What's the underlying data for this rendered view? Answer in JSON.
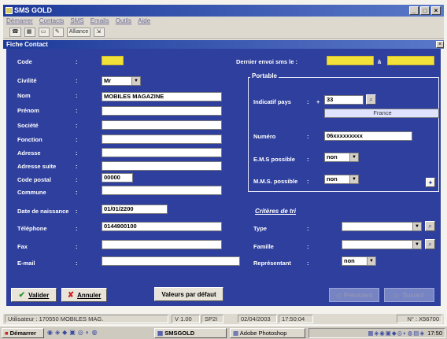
{
  "window": {
    "title": "SMS GOLD",
    "menu": [
      "Démarrer",
      "Contacts",
      "SMS",
      "Emails",
      "Outils",
      "Aide"
    ],
    "toolbar": [
      "Alliance"
    ]
  },
  "dialog": {
    "title": "Fiche Contact"
  },
  "form": {
    "code": {
      "label": "Code",
      "value": ""
    },
    "civilite": {
      "label": "Civilité",
      "value": "Mr"
    },
    "nom": {
      "label": "Nom",
      "value": "MOBILES MAGAZINE"
    },
    "prenom": {
      "label": "Prénom",
      "value": ""
    },
    "societe": {
      "label": "Société",
      "value": ""
    },
    "fonction": {
      "label": "Fonction",
      "value": ""
    },
    "adresse": {
      "label": "Adresse",
      "value": ""
    },
    "adresse_suite": {
      "label": "Adresse suite",
      "value": ""
    },
    "code_postal": {
      "label": "Code postal",
      "value": "00000"
    },
    "commune": {
      "label": "Commune",
      "value": ""
    },
    "date_naissance": {
      "label": "Date de naissance",
      "value": "01/01/2200"
    },
    "telephone": {
      "label": "Téléphone",
      "value": "0144900100"
    },
    "fax": {
      "label": "Fax",
      "value": ""
    },
    "email": {
      "label": "E-mail",
      "value": ""
    }
  },
  "right": {
    "dernier_envoi": {
      "label": "Dernier envoi sms le :",
      "sep": "à",
      "from": "",
      "to": ""
    },
    "portable": {
      "legend": "Portable",
      "indicatif_label": "Indicatif pays",
      "plus": "+",
      "indicatif_value": "33",
      "country": "France",
      "numero_label": "Numéro",
      "numero_value": "06xxxxxxxxx",
      "ems_label": "E.M.S possible",
      "ems_value": "non",
      "mms_label": "M.M.S. possible",
      "mms_value": "non"
    },
    "criteres": {
      "title": "Critères de tri",
      "type_label": "Type",
      "type_value": "",
      "famille_label": "Famille",
      "famille_value": "",
      "representant_label": "Représentant",
      "representant_value": "non"
    }
  },
  "buttons": {
    "valider": "Valider",
    "annuler": "Annuler",
    "defaut": "Valeurs par défaut",
    "precedent": "Précédent",
    "suivant": "Suivant"
  },
  "status": {
    "user": "Utilisateur : 170550 MOBILES MAG.",
    "version": "V 1.00",
    "sp": "SP2I",
    "date": "02/04/2003",
    "time": "17:50:04",
    "num": "N° : X56700"
  },
  "taskbar": {
    "start": "Démarrer",
    "app1": "SMSGOLD",
    "app2": "Adobe Photoshop",
    "clock": "17:50"
  },
  "colors": {
    "panel": "#2e3f9e",
    "yellow": "#f2e138",
    "titlebar": "#1e3a9a"
  }
}
